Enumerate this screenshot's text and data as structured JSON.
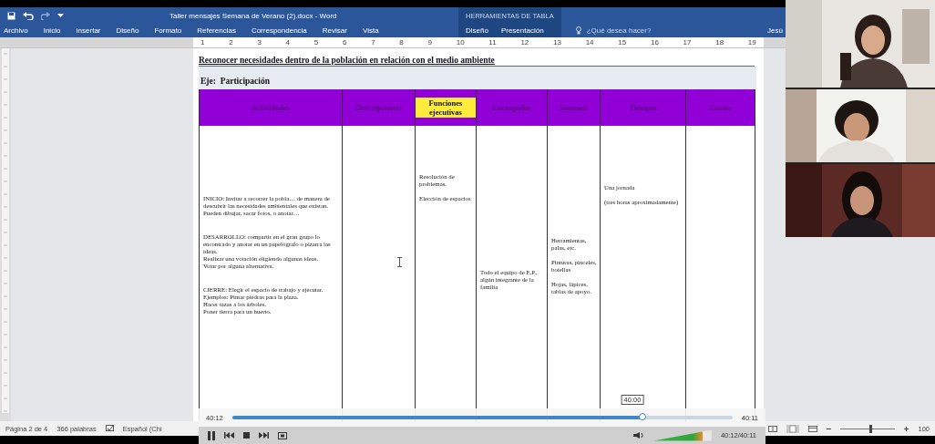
{
  "window": {
    "title": "Taller mensajes Semana de Verano (2).docx - Word",
    "context_label": "HERRAMIENTAS DE TABLA"
  },
  "ribbon_tabs": [
    {
      "label": "Archivo",
      "kind": "main"
    },
    {
      "label": "Inicio",
      "kind": "main"
    },
    {
      "label": "Insertar",
      "kind": "main"
    },
    {
      "label": "Diseño",
      "kind": "main"
    },
    {
      "label": "Formato",
      "kind": "main"
    },
    {
      "label": "Referencias",
      "kind": "main"
    },
    {
      "label": "Correspondencia",
      "kind": "main"
    },
    {
      "label": "Revisar",
      "kind": "main"
    },
    {
      "label": "Vista",
      "kind": "main"
    },
    {
      "label": "Diseño",
      "kind": "context"
    },
    {
      "label": "Presentación",
      "kind": "context"
    }
  ],
  "search": {
    "placeholder": "¿Qué desea hacer?"
  },
  "user": "Jesú",
  "ruler": [
    "1",
    "2",
    "3",
    "4",
    "5",
    "6",
    "7",
    "8",
    "9",
    "10",
    "11",
    "12",
    "13",
    "14",
    "15",
    "16",
    "17",
    "18",
    "19"
  ],
  "document": {
    "heading": "Reconocer necesidades dentro de la población en relación con el medio ambiente",
    "axis": "Eje:  Participación",
    "table": {
      "columns": [
        {
          "label": "Actividades",
          "highlighted": false
        },
        {
          "label": "Descripciones",
          "highlighted": false
        },
        {
          "label": "Funciones ejecutivas",
          "highlighted": true
        },
        {
          "label": "Encargados",
          "highlighted": false
        },
        {
          "label": "Insumos",
          "highlighted": false
        },
        {
          "label": "Tiempos",
          "highlighted": false
        },
        {
          "label": "Costos",
          "highlighted": false
        }
      ],
      "cells": [
        {
          "paragraphs": [
            [
              "INICIO: Invitar a recorrer la pobla… de manera de descubrir las necesidades ambientales que existan.",
              "Pueden dibujar, sacar fotos, o anotar…"
            ],
            [
              "DESARROLLO: compartir en el gran grupo lo encontrado y anotar en un papelógrafo o pizarra las ideas.",
              "Realizar una votación eligiendo algunas ideas.",
              "Votar por alguna alternativa."
            ],
            [
              "CIERRE: Elegir el espacio de trabajo y ejecutar.",
              "Ejemplos: Pintar piedras para la plaza.",
              "Hacer tazas a los árboles.",
              "Poner tierra para un huerto."
            ]
          ]
        },
        {
          "cursor": true
        },
        {
          "paragraphs": [
            [
              "Resolución de problemas."
            ],
            [
              "Elección de espacios"
            ]
          ]
        },
        {
          "paragraphs": [
            [
              "Todo el equipo de E.P., algún integrante de la familia"
            ]
          ]
        },
        {
          "paragraphs": [
            [
              "Herramientas, palas, etc."
            ],
            [
              "Pinturas, pinceles, botellas"
            ],
            [
              "Hojas, lápices, tablas de apoyo."
            ]
          ]
        },
        {
          "paragraphs": [
            [
              "Una jornada"
            ],
            [
              "(tres horas aproximadamente)"
            ]
          ]
        },
        {}
      ]
    }
  },
  "media_player": {
    "elapsed": "40:12",
    "remaining": "40:11",
    "level": 0.82,
    "tooltip": "40:00",
    "position": "40:12/40:11",
    "volume": {
      "level": 0.85
    }
  },
  "status_bar": {
    "page": "Página 2 de 4",
    "words": "366 palabras",
    "language": "Español (Chi",
    "zoom": {
      "level": 0.55
    },
    "zoom_label": "100"
  }
}
